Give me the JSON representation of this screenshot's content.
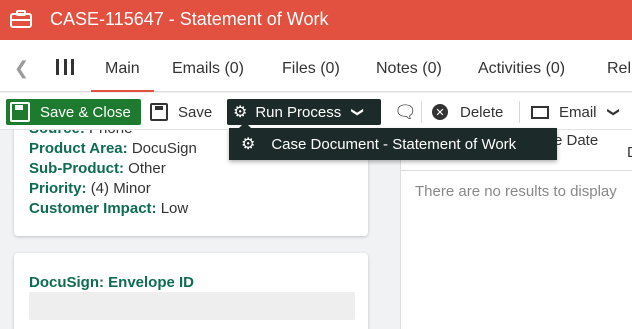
{
  "window": {
    "title": "CASE-115647 - Statement of Work"
  },
  "tabs": [
    {
      "label": "Main",
      "active": true
    },
    {
      "label": "Emails (0)"
    },
    {
      "label": "Files (0)"
    },
    {
      "label": "Notes (0)"
    },
    {
      "label": "Activities (0)"
    },
    {
      "label": "Rel"
    }
  ],
  "toolbar": {
    "save_close": "Save & Close",
    "save": "Save",
    "run_process": "Run Process",
    "delete": "Delete",
    "email": "Email"
  },
  "dropdown": {
    "items": [
      {
        "label": "Case Document - Statement of Work"
      }
    ]
  },
  "details": {
    "source": {
      "label": "Source:",
      "value": "Phone"
    },
    "product_area": {
      "label": "Product Area:",
      "value": "DocuSign"
    },
    "sub_product": {
      "label": "Sub-Product:",
      "value": "Other"
    },
    "priority": {
      "label": "Priority:",
      "value": "(4) Minor"
    },
    "customer_impact": {
      "label": "Customer Impact:",
      "value": "Low"
    }
  },
  "docusign": {
    "label": "DocuSign: Envelope ID",
    "value": ""
  },
  "right_panel": {
    "header_partial": "e Date",
    "header_partial2": "D",
    "empty_message": "There are no results to display"
  },
  "colors": {
    "title_bar": "#e2503f",
    "primary_green": "#1e7a2e",
    "dark_button": "#1c2b29",
    "label_green": "#0f6b52"
  }
}
